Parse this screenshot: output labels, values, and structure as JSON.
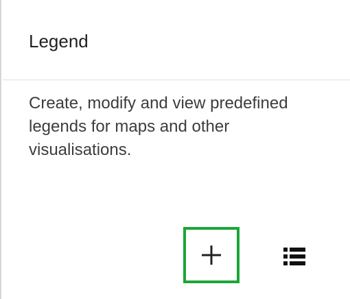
{
  "card": {
    "title": "Legend",
    "description": "Create, modify and view predefined legends for maps and other visualisations."
  },
  "actions": [
    {
      "name": "add-button",
      "icon": "plus-icon"
    },
    {
      "name": "list-button",
      "icon": "list-icon"
    }
  ],
  "colors": {
    "focus_outline": "#1aa636",
    "text_primary": "#212121",
    "text_secondary": "#3c3c3c",
    "border": "#d6d6d6"
  }
}
